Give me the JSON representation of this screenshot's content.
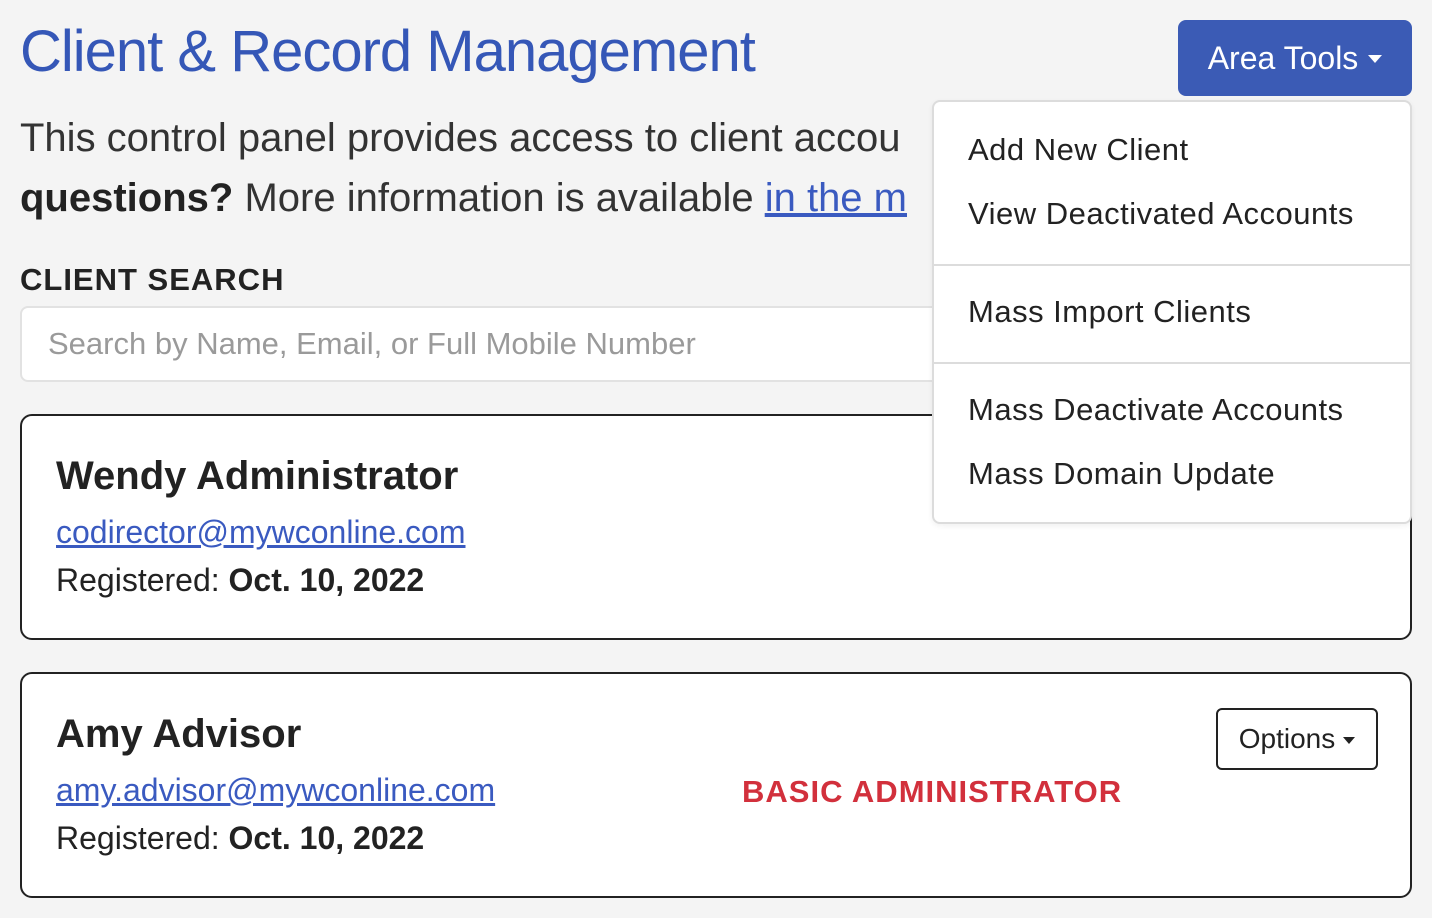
{
  "header": {
    "title": "Client & Record Management",
    "area_tools_label": "Area Tools"
  },
  "intro": {
    "text_part1": "This control panel provides access to client accou",
    "bold_part": "questions?",
    "text_part2": " More information is available ",
    "link_text": "in the m"
  },
  "search": {
    "label": "CLIENT SEARCH",
    "placeholder": "Search by Name, Email, or Full Mobile Number",
    "value": ""
  },
  "clients": [
    {
      "name": "Wendy Administrator",
      "email": "codirector@mywconline.com",
      "registered_label": "Registered: ",
      "registered_date": "Oct. 10, 2022"
    },
    {
      "name": "Amy Advisor",
      "email": "amy.advisor@mywconline.com",
      "registered_label": "Registered: ",
      "registered_date": "Oct. 10, 2022",
      "role": "BASIC ADMINISTRATOR",
      "options_label": "Options"
    }
  ],
  "area_tools_menu": {
    "items": [
      "Add New Client",
      "View Deactivated Accounts",
      "Mass Import Clients",
      "Mass Deactivate Accounts",
      "Mass Domain Update"
    ]
  },
  "colors": {
    "title_blue": "#3557b7",
    "button_blue": "#3b5bb5",
    "link_blue": "#3a5ac0",
    "role_red": "#d2303c",
    "background": "#f4f4f4"
  },
  "icons": {
    "dropdown_caret": "caret-down-icon"
  }
}
